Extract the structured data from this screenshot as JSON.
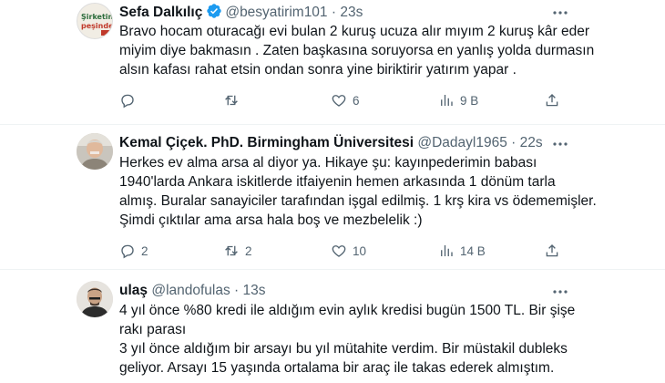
{
  "tweets": [
    {
      "name": "Sefa Dalkılıç",
      "handle": "@besyatirim101",
      "dot": "·",
      "time": "23s",
      "avatar_text": "Şirketin peşinde",
      "lines": [
        "Bravo hocam oturacağı evi bulan 2 kuruş ucuza alır mıyım 2 kuruş kâr eder",
        "miyim diye bakmasın . Zaten başkasına soruyorsa en yanlış yolda durmasın",
        "alsın kafası rahat etsin ondan sonra yine biriktirir yatırım yapar ."
      ],
      "replies": "",
      "retweets": "",
      "likes": "6",
      "views": "9 B"
    },
    {
      "name": "Kemal Çiçek. PhD. Birmingham Üniversitesi",
      "handle": "@Dadayl1965",
      "dot": "·",
      "time": "22s",
      "lines": [
        "Herkes ev alma arsa al diyor ya. Hikaye şu: kayınpederimin babası",
        "1940'larda Ankara iskitlerde itfaiyenin hemen arkasında 1 dönüm tarla",
        "almış. Buralar sanayiciler tarafından işgal edilmiş. 1 krş kira vs ödememişler.",
        "Şimdi çıktılar ama arsa hala boş ve mezbelelik :)"
      ],
      "replies": "2",
      "retweets": "2",
      "likes": "10",
      "views": "14 B"
    },
    {
      "name": "ulaş",
      "handle": "@landofulas",
      "dot": "·",
      "time": "13s",
      "lines": [
        "4 yıl önce %80 kredi ile aldığım evin aylık kredisi bugün 1500 TL. Bir şişe",
        "rakı parası",
        "3 yıl önce aldığım bir arsayı bu yıl mütahite verdim. Bir müstakil dubleks",
        "geliyor. Arsayı 15 yaşında ortalama bir araç ile takas ederek almıştım."
      ]
    }
  ],
  "colors": {
    "text": "#0f1419",
    "secondary": "#536471",
    "verified": "#1d9bf0",
    "divider": "#eff3f4"
  }
}
